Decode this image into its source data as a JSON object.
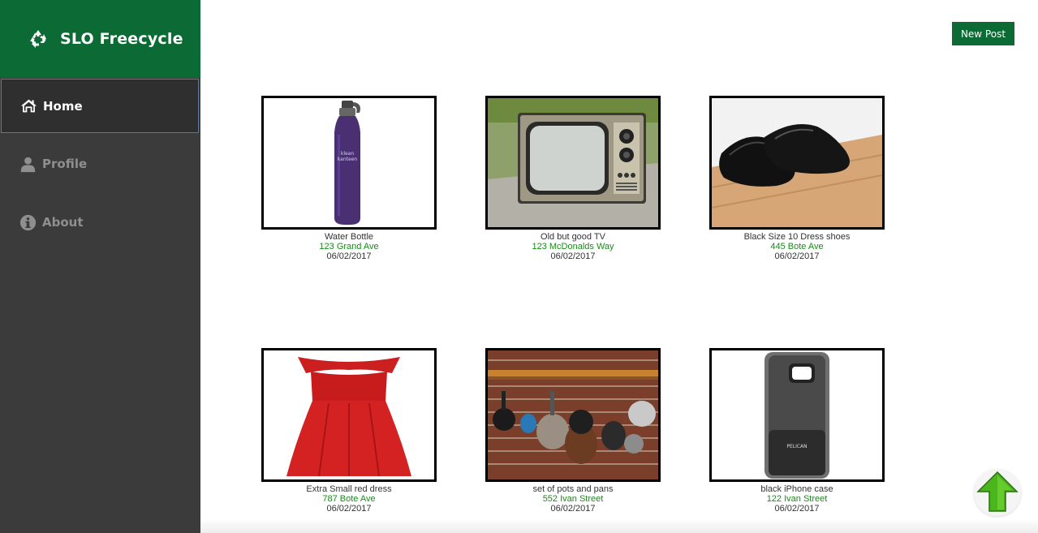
{
  "app": {
    "title": "SLO Freecycle",
    "brand_color": "#0c6b34",
    "sidebar_color": "#3b3b3b",
    "address_color": "#1a8a1a"
  },
  "nav": {
    "items": [
      {
        "label": "Home",
        "icon": "home-icon",
        "active": true
      },
      {
        "label": "Profile",
        "icon": "user-icon",
        "active": false
      },
      {
        "label": "About",
        "icon": "info-icon",
        "active": false
      }
    ]
  },
  "toolbar": {
    "new_post_label": "New Post"
  },
  "posts": [
    {
      "name": "Water Bottle",
      "address": "123 Grand Ave",
      "date": "06/02/2017",
      "image": "water-bottle"
    },
    {
      "name": "Old but good TV",
      "address": "123 McDonalds Way",
      "date": "06/02/2017",
      "image": "tv"
    },
    {
      "name": "Black Size 10 Dress shoes",
      "address": "445 Bote Ave",
      "date": "06/02/2017",
      "image": "dress-shoes"
    },
    {
      "name": "Extra Small red dress",
      "address": "787 Bote Ave",
      "date": "06/02/2017",
      "image": "red-dress"
    },
    {
      "name": "set of pots and pans",
      "address": "552 Ivan Street",
      "date": "06/02/2017",
      "image": "pots-and-pans"
    },
    {
      "name": "black iPhone case",
      "address": "122 Ivan Street",
      "date": "06/02/2017",
      "image": "iphone-case"
    }
  ],
  "scroll_top": {
    "icon": "arrow-up-icon"
  }
}
